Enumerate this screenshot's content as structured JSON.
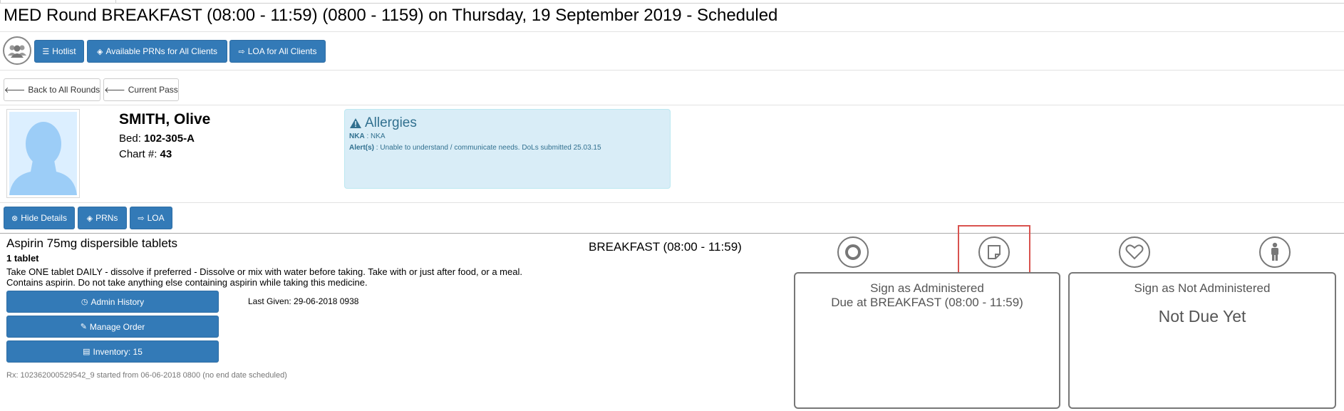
{
  "page": {
    "title": "MED Round BREAKFAST (08:00 - 11:59) (0800 - 1159) on Thursday, 19 September 2019 - Scheduled"
  },
  "toolbar": {
    "group_icon": "users-icon",
    "hotlist": "Hotlist",
    "available_prns": "Available PRNs for All Clients",
    "loa_all": "LOA for All Clients"
  },
  "nav": {
    "back": "Back to All Rounds",
    "current_pass": "Current Pass"
  },
  "patient": {
    "name": "SMITH, Olive",
    "bed_label": "Bed:",
    "bed": "102-305-A",
    "chart_label": "Chart #:",
    "chart": "43"
  },
  "allergies": {
    "title": "Allergies",
    "nka_label": "NKA",
    "nka_value": "NKA",
    "alerts_label": "Alert(s)",
    "alerts_value": "Unable to understand / communicate needs. DoLs submitted 25.03.15"
  },
  "patient_actions": {
    "hide_details": "Hide Details",
    "prns": "PRNs",
    "loa": "LOA"
  },
  "medication": {
    "name": "Aspirin 75mg dispersible tablets",
    "quantity": "1 tablet",
    "instructions": "Take ONE tablet DAILY - dissolve if preferred - Dissolve or mix with water before taking. Take with or just after food, or a meal. Contains aspirin. Do not take anything else containing aspirin while taking this medicine.",
    "admin_history": "Admin History",
    "manage_order": "Manage Order",
    "inventory": "Inventory: 15",
    "last_given": "Last Given: 29-06-2018 0938",
    "rx": "Rx: 102362000529542_9 started from 06-06-2018 0800 (no end date scheduled)",
    "round": "BREAKFAST (08:00 - 11:59)"
  },
  "status_icons": [
    "circle-icon",
    "note-icon",
    "heart-icon",
    "person-icon"
  ],
  "sign_administered": {
    "title": "Sign as Administered",
    "due": "Due at BREAKFAST (08:00 - 11:59)"
  },
  "sign_not_administered": {
    "title": "Sign as Not Administered",
    "status": "Not Due Yet"
  },
  "colors": {
    "primary": "#337ab7",
    "alert_bg": "#d9edf7",
    "alert_text": "#31708f",
    "highlight": "#d9534f"
  }
}
